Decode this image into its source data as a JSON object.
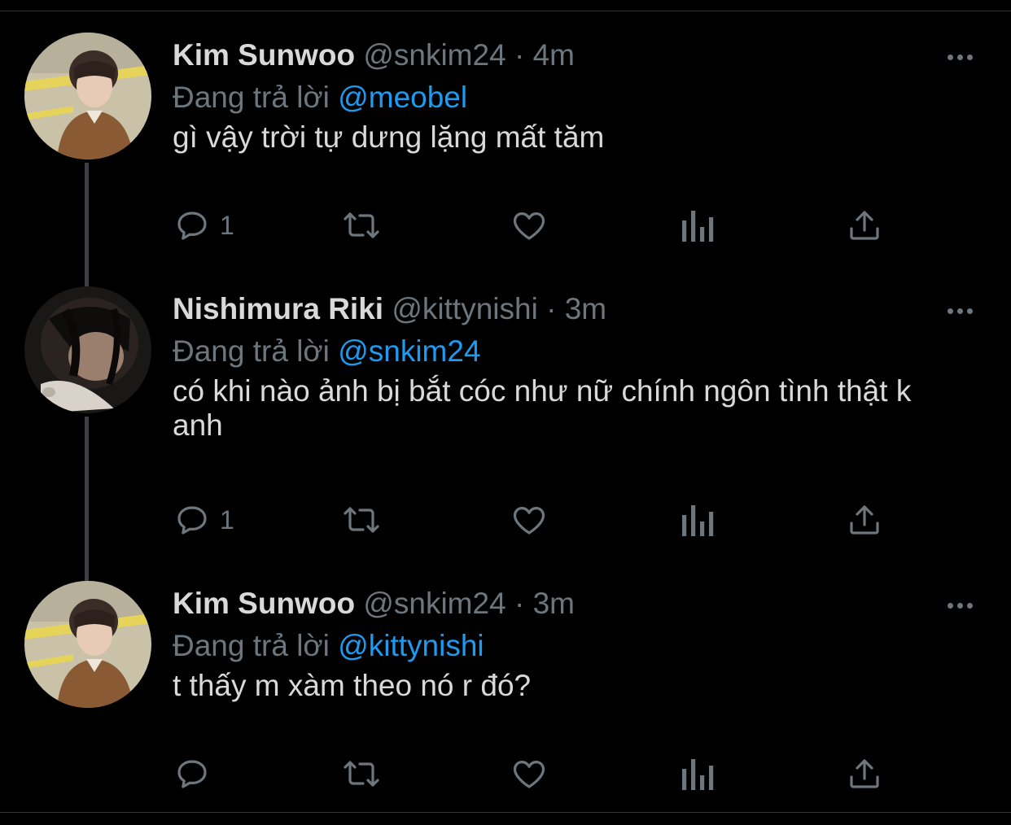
{
  "reply_prefix": "Đang trả lời",
  "colors": {
    "background": "#000000",
    "text": "#d9d9d9",
    "secondary": "#6e767d",
    "accent": "#1d9bf0",
    "thread_line": "#3d4145"
  },
  "tweets": [
    {
      "name": "Kim Sunwoo",
      "handle": "@snkim24",
      "separator": "·",
      "time": "4m",
      "replying_to": "@meobel",
      "text": "gì vậy trời tự dưng lặng mất tăm",
      "reply_count": "1",
      "avatar": "avatar-photo"
    },
    {
      "name": "Nishimura Riki",
      "handle": "@kittynishi",
      "separator": "·",
      "time": "3m",
      "replying_to": "@snkim24",
      "text": "có khi nào ảnh bị bắt cóc như nữ chính ngôn tình thật k anh",
      "reply_count": "1",
      "avatar": "avatar-photo"
    },
    {
      "name": "Kim Sunwoo",
      "handle": "@snkim24",
      "separator": "·",
      "time": "3m",
      "replying_to": "@kittynishi",
      "text": "t thấy m xàm theo nó r đó?",
      "reply_count": "",
      "avatar": "avatar-photo"
    }
  ]
}
